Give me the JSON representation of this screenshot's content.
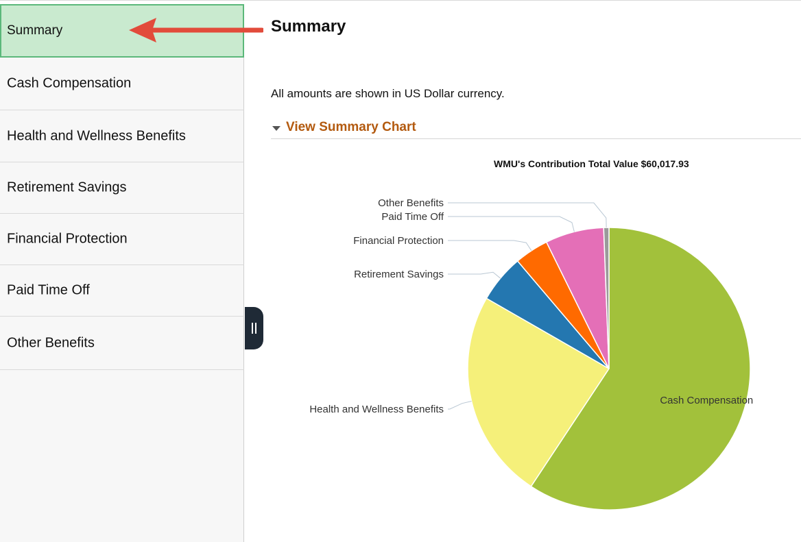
{
  "sidebar": {
    "items": [
      {
        "label": "Summary",
        "active": true
      },
      {
        "label": "Cash Compensation"
      },
      {
        "label": "Health and Wellness Benefits"
      },
      {
        "label": "Retirement Savings"
      },
      {
        "label": "Financial Protection"
      },
      {
        "label": "Paid Time Off"
      },
      {
        "label": "Other Benefits"
      }
    ]
  },
  "main": {
    "title": "Summary",
    "currency_note": "All amounts are shown in US Dollar currency.",
    "section_toggle": "View Summary Chart"
  },
  "chart_data": {
    "type": "pie",
    "title": "WMU's Contribution Total Value $60,017.93",
    "categories": [
      "Cash Compensation",
      "Health and Wellness Benefits",
      "Retirement Savings",
      "Financial Protection",
      "Paid Time Off",
      "Other Benefits"
    ],
    "values": [
      59.3,
      24.0,
      5.5,
      3.9,
      6.7,
      0.6
    ],
    "unit": "percent of total",
    "colors": [
      "#a2c13b",
      "#f5f07a",
      "#2477b0",
      "#ff6a00",
      "#e46fb7",
      "#9a9a9a"
    ]
  },
  "colors": {
    "active_bg": "#c9eacf",
    "active_border": "#5bb87a",
    "accent_link": "#b35a0f",
    "annotation_arrow": "#e24b3b"
  },
  "icons": {
    "collapse": "pause-bars-icon",
    "toggle": "triangle-down-icon",
    "annotation": "arrow-left-icon"
  }
}
